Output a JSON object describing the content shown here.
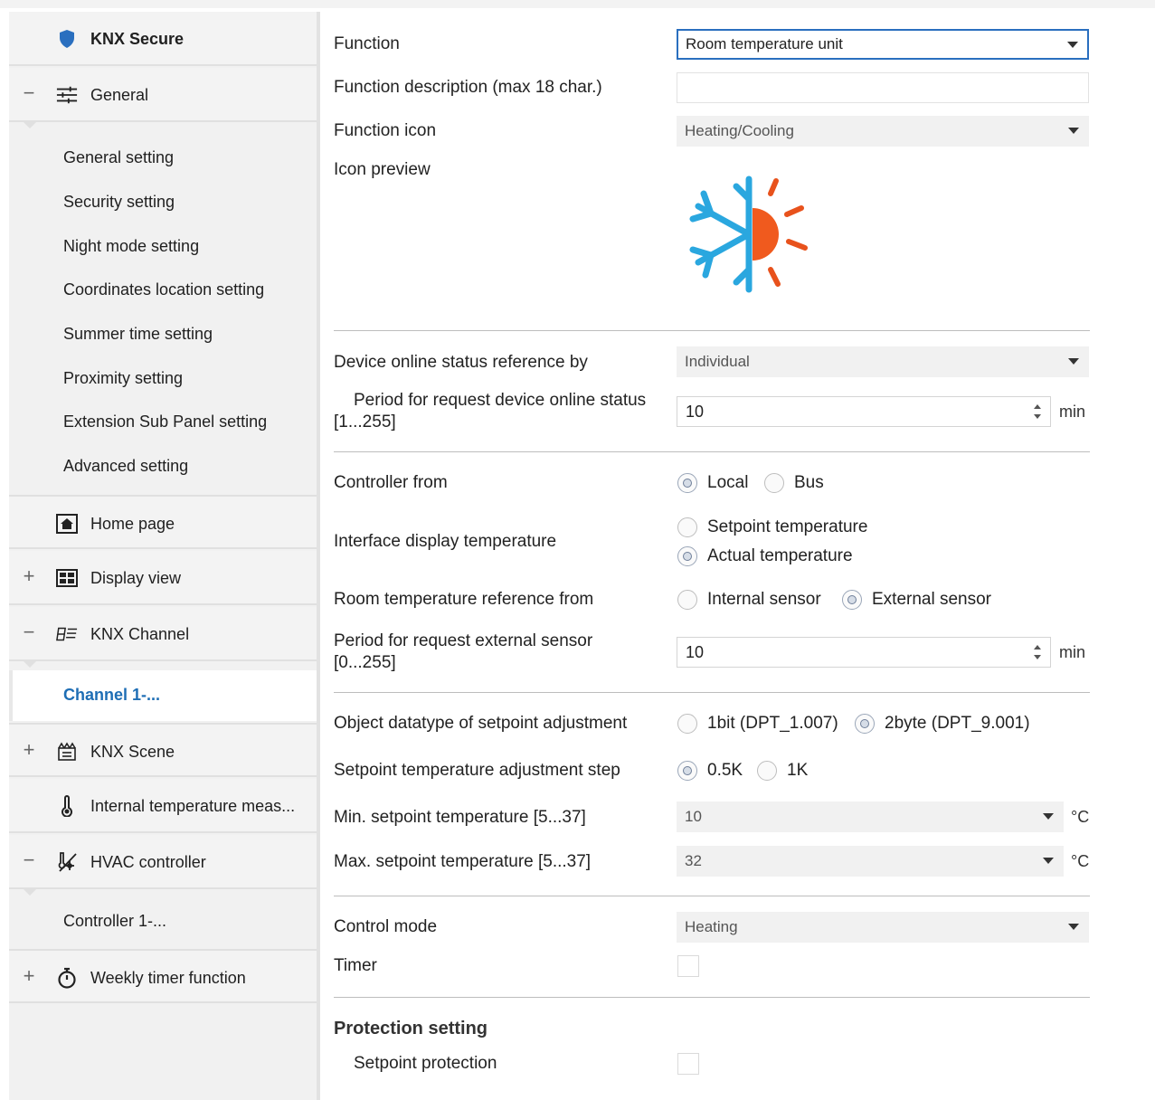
{
  "sidebar": {
    "items": [
      {
        "label": "KNX Secure",
        "icon": "shield-icon",
        "toggle": ""
      },
      {
        "label": "General",
        "icon": "sliders-icon",
        "toggle": "−"
      },
      {
        "label": "General setting"
      },
      {
        "label": "Security setting"
      },
      {
        "label": "Night mode setting"
      },
      {
        "label": "Coordinates location setting"
      },
      {
        "label": "Summer time setting"
      },
      {
        "label": "Proximity setting"
      },
      {
        "label": "Extension Sub Panel setting"
      },
      {
        "label": "Advanced setting"
      },
      {
        "label": "Home page",
        "icon": "home-icon",
        "toggle": ""
      },
      {
        "label": "Display view",
        "icon": "display-grid-icon",
        "toggle": "+"
      },
      {
        "label": "KNX Channel",
        "icon": "channel-icon",
        "toggle": "−"
      },
      {
        "label": "Channel 1-..."
      },
      {
        "label": "KNX Scene",
        "icon": "scene-icon",
        "toggle": "+"
      },
      {
        "label": "Internal temperature meas...",
        "icon": "thermometer-icon",
        "toggle": ""
      },
      {
        "label": "HVAC controller",
        "icon": "hvac-icon",
        "toggle": "−"
      },
      {
        "label": "Controller 1-..."
      },
      {
        "label": "Weekly timer function",
        "icon": "stopwatch-icon",
        "toggle": "+"
      }
    ]
  },
  "main": {
    "function": {
      "label": "Function",
      "value": "Room temperature unit"
    },
    "function_description": {
      "label": "Function description (max 18 char.)",
      "value": ""
    },
    "function_icon": {
      "label": "Function icon",
      "value": "Heating/Cooling"
    },
    "icon_preview": {
      "label": "Icon preview",
      "icon": "heating-cooling-icon"
    },
    "device_online_status": {
      "label": "Device online status reference by",
      "value": "Individual"
    },
    "period_device_status": {
      "label_line1": "Period for request device online status",
      "label_line2": "[1...255]",
      "value": "10",
      "unit": "min"
    },
    "controller_from": {
      "label": "Controller from",
      "options": [
        "Local",
        "Bus"
      ],
      "selected": "Local"
    },
    "interface_display_temperature": {
      "label": "Interface display temperature",
      "options": [
        "Setpoint temperature",
        "Actual temperature"
      ],
      "selected": "Actual temperature"
    },
    "room_temperature_reference": {
      "label": "Room temperature reference from",
      "options": [
        "Internal sensor",
        "External sensor"
      ],
      "selected": "External sensor"
    },
    "period_external_sensor": {
      "label_line1": "Period for request external sensor",
      "label_line2": "[0...255]",
      "value": "10",
      "unit": "min"
    },
    "object_datatype": {
      "label": "Object datatype of setpoint adjustment",
      "options": [
        "1bit (DPT_1.007)",
        "2byte (DPT_9.001)"
      ],
      "selected": "2byte (DPT_9.001)"
    },
    "setpoint_step": {
      "label": "Setpoint temperature adjustment step",
      "options": [
        "0.5K",
        "1K"
      ],
      "selected": "0.5K"
    },
    "min_setpoint": {
      "label": "Min. setpoint temperature [5...37]",
      "value": "10",
      "unit": "°C"
    },
    "max_setpoint": {
      "label": "Max. setpoint temperature [5...37]",
      "value": "32",
      "unit": "°C"
    },
    "control_mode": {
      "label": "Control mode",
      "value": "Heating"
    },
    "timer": {
      "label": "Timer",
      "checked": false
    },
    "protection_setting": {
      "title": "Protection setting"
    },
    "setpoint_protection": {
      "label": "Setpoint protection",
      "checked": false
    }
  },
  "colors": {
    "accent": "#2a6fbf",
    "active_nav": "#1e6eb5",
    "sun": "#f05a1e",
    "snow": "#2aa7df"
  }
}
